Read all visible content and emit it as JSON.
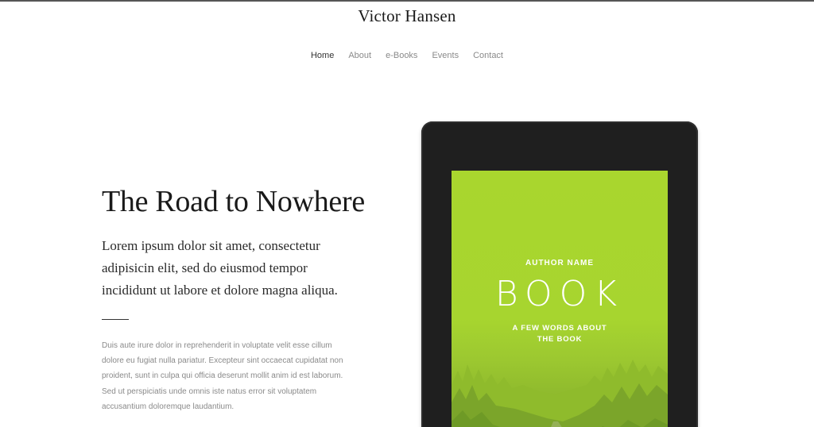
{
  "site": {
    "title": "Victor Hansen"
  },
  "nav": {
    "items": [
      {
        "label": "Home",
        "active": true
      },
      {
        "label": "About",
        "active": false
      },
      {
        "label": "e-Books",
        "active": false
      },
      {
        "label": "Events",
        "active": false
      },
      {
        "label": "Contact",
        "active": false
      }
    ]
  },
  "hero": {
    "title": "The Road to Nowhere",
    "lead": "Lorem ipsum dolor sit amet, consectetur adipisicin elit, sed do eiusmod tempor incididunt ut labore et dolore magna aliqua.",
    "body": "Duis aute irure dolor in reprehenderit in voluptate velit esse cillum dolore eu fugiat nulla pariatur. Excepteur sint occaecat cupidatat non proident, sunt in culpa qui officia deserunt mollit anim id est laborum. Sed ut perspiciatis unde omnis iste natus error sit voluptatem accusantium doloremque laudantium."
  },
  "book_cover": {
    "author": "AUTHOR NAME",
    "title": "BOOK",
    "tagline": "A FEW WORDS ABOUT THE BOOK",
    "colors": {
      "cover": "#a9d62e",
      "device": "#1f1f1f"
    }
  }
}
